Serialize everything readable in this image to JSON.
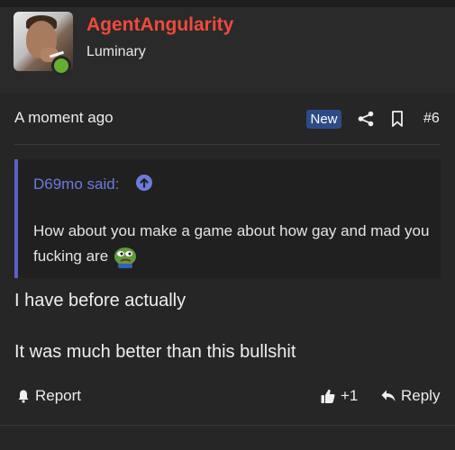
{
  "post": {
    "author": "AgentAngularity",
    "author_title": "Luminary",
    "time": "A moment ago",
    "new_badge": "New",
    "post_number": "#6",
    "quote": {
      "author_said": "D69mo said:",
      "text": "How about you make a game about how gay and mad you fucking are"
    },
    "message_lines": [
      "I have before actually",
      "It was much better than this bullshit"
    ],
    "actions": {
      "report": "Report",
      "like_count": "+1",
      "reply": "Reply"
    }
  },
  "icons": {
    "share": "share-icon",
    "bookmark": "bookmark-icon",
    "quote_jump": "arrow-up-circle-icon",
    "report": "bell-icon",
    "like": "thumbs-up-icon",
    "reply": "reply-icon",
    "emoji": "pepe-emoji"
  },
  "colors": {
    "background": "#262626",
    "username": "#ef4a3d",
    "quote_accent": "#5c62c5",
    "quote_author": "#6b7bdd",
    "new_badge": "#2d4b86",
    "online": "#63b031"
  }
}
